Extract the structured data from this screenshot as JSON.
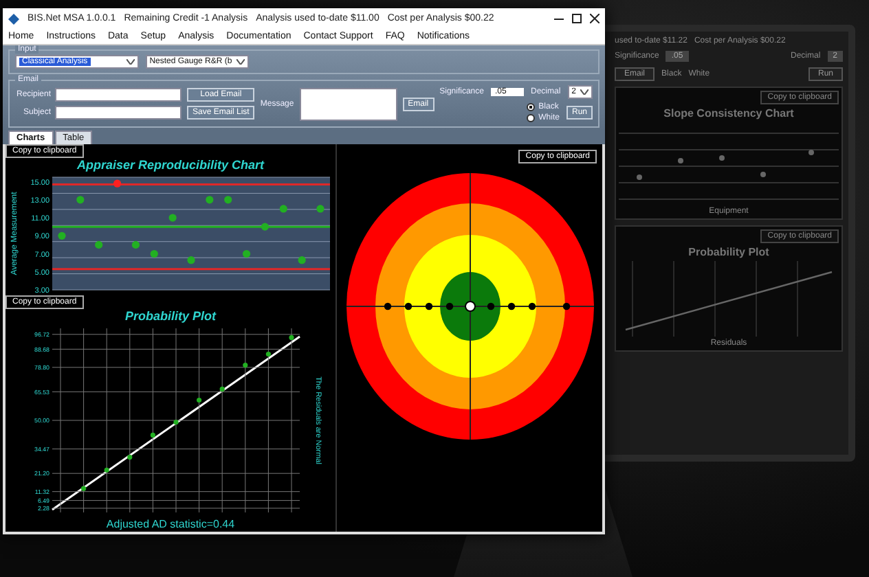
{
  "title_bar": {
    "app": "BIS.Net MSA 1.0.0.1",
    "credit": "Remaining Credit -1 Analysis",
    "used": "Analysis used to-date $11.00",
    "cost": "Cost per Analysis $00.22"
  },
  "menu": [
    "Home",
    "Instructions",
    "Data",
    "Setup",
    "Analysis",
    "Documentation",
    "Contact Support",
    "FAQ",
    "Notifications"
  ],
  "input": {
    "group_label": "Input",
    "analysis_type": "Classical Analysis",
    "model": "Nested Gauge R&R (b"
  },
  "email": {
    "group_label": "Email",
    "recipient_label": "Recipient",
    "subject_label": "Subject",
    "load_button": "Load Email",
    "save_button": "Save Email List",
    "message_label": "Message",
    "send_button": "Email"
  },
  "significance": {
    "label": "Significance",
    "value": ".05"
  },
  "decimal": {
    "label": "Decimal",
    "value": "2"
  },
  "colors": [
    {
      "label": "Black",
      "selected": true
    },
    {
      "label": "White",
      "selected": false
    }
  ],
  "run_button": "Run",
  "tabs": [
    {
      "label": "Charts",
      "selected": true
    },
    {
      "label": "Table",
      "selected": false
    }
  ],
  "reproducibility_chart": {
    "copy_button": "Copy to clipboard",
    "chart_data": {
      "type": "scatter",
      "title": "Appraiser Reproducibility Chart",
      "ylabel": "Average Measurement",
      "ylim": [
        3,
        15.5
      ],
      "yticks": [
        {
          "value": 3,
          "label": "3.00"
        },
        {
          "value": 5,
          "label": "5.00"
        },
        {
          "value": 7,
          "label": "7.00"
        },
        {
          "value": 9,
          "label": "9.00"
        },
        {
          "value": 11,
          "label": "11.00"
        },
        {
          "value": 13,
          "label": "13.00"
        },
        {
          "value": 15,
          "label": "15.00"
        }
      ],
      "series": [
        {
          "color": "#22b022",
          "values": [
            9,
            13,
            8,
            null,
            8,
            7,
            11,
            6.3,
            13,
            13,
            7,
            10,
            12,
            6.3,
            12
          ]
        },
        {
          "color": "#ff2020",
          "values": [
            null,
            null,
            null,
            14.8,
            null,
            null,
            null,
            null,
            null,
            null,
            null,
            null,
            null,
            null,
            null
          ]
        }
      ],
      "ref_lines": [
        {
          "axis": "y",
          "value": 14.7,
          "color": "#e02828"
        },
        {
          "axis": "y",
          "value": 10,
          "color": "#22b022"
        },
        {
          "axis": "y",
          "value": 5.3,
          "color": "#e02828"
        }
      ]
    }
  },
  "probability_chart": {
    "copy_button": "Copy to clipboard",
    "footer": "Adjusted AD statistic=0.44",
    "chart_data": {
      "type": "scatter",
      "title": "Probability Plot",
      "ylabel": "The Residuals are Normal",
      "grid": true,
      "ylim": [
        0,
        100
      ],
      "yticks": [
        {
          "value": 2.28,
          "label": "2.28"
        },
        {
          "value": 6.49,
          "label": "6.49"
        },
        {
          "value": 11.32,
          "label": "11.32"
        },
        {
          "value": 21.2,
          "label": "21.20"
        },
        {
          "value": 34.47,
          "label": "34.47"
        },
        {
          "value": 50,
          "label": "50.00"
        },
        {
          "value": 65.53,
          "label": "65.53"
        },
        {
          "value": 78.8,
          "label": "78.80"
        },
        {
          "value": 88.68,
          "label": "88.68"
        },
        {
          "value": 96.72,
          "label": "96.72"
        }
      ],
      "series": [
        {
          "color": "#22b022",
          "values": [
            null,
            13,
            23,
            30,
            42,
            49,
            61,
            67,
            80,
            86,
            95
          ]
        }
      ]
    }
  },
  "target_chart": {
    "copy_button": "Copy to clipboard"
  },
  "background_screen": {
    "used": "used to-date $11.22",
    "cost": "Cost per Analysis $00.22",
    "significance_label": "Significance",
    "significance_value": ".05",
    "decimal_label": "Decimal",
    "decimal_value": "2",
    "email_button": "Email",
    "run_button": "Run",
    "colors": [
      "Black",
      "White"
    ],
    "slope_chart": {
      "copy_button": "Copy to clipboard",
      "title": "Slope Consistency Chart",
      "xlabel": "Equipment"
    },
    "probability_chart": {
      "copy_button": "Copy to clipboard",
      "title": "Probability Plot",
      "xlabel": "Residuals"
    }
  }
}
